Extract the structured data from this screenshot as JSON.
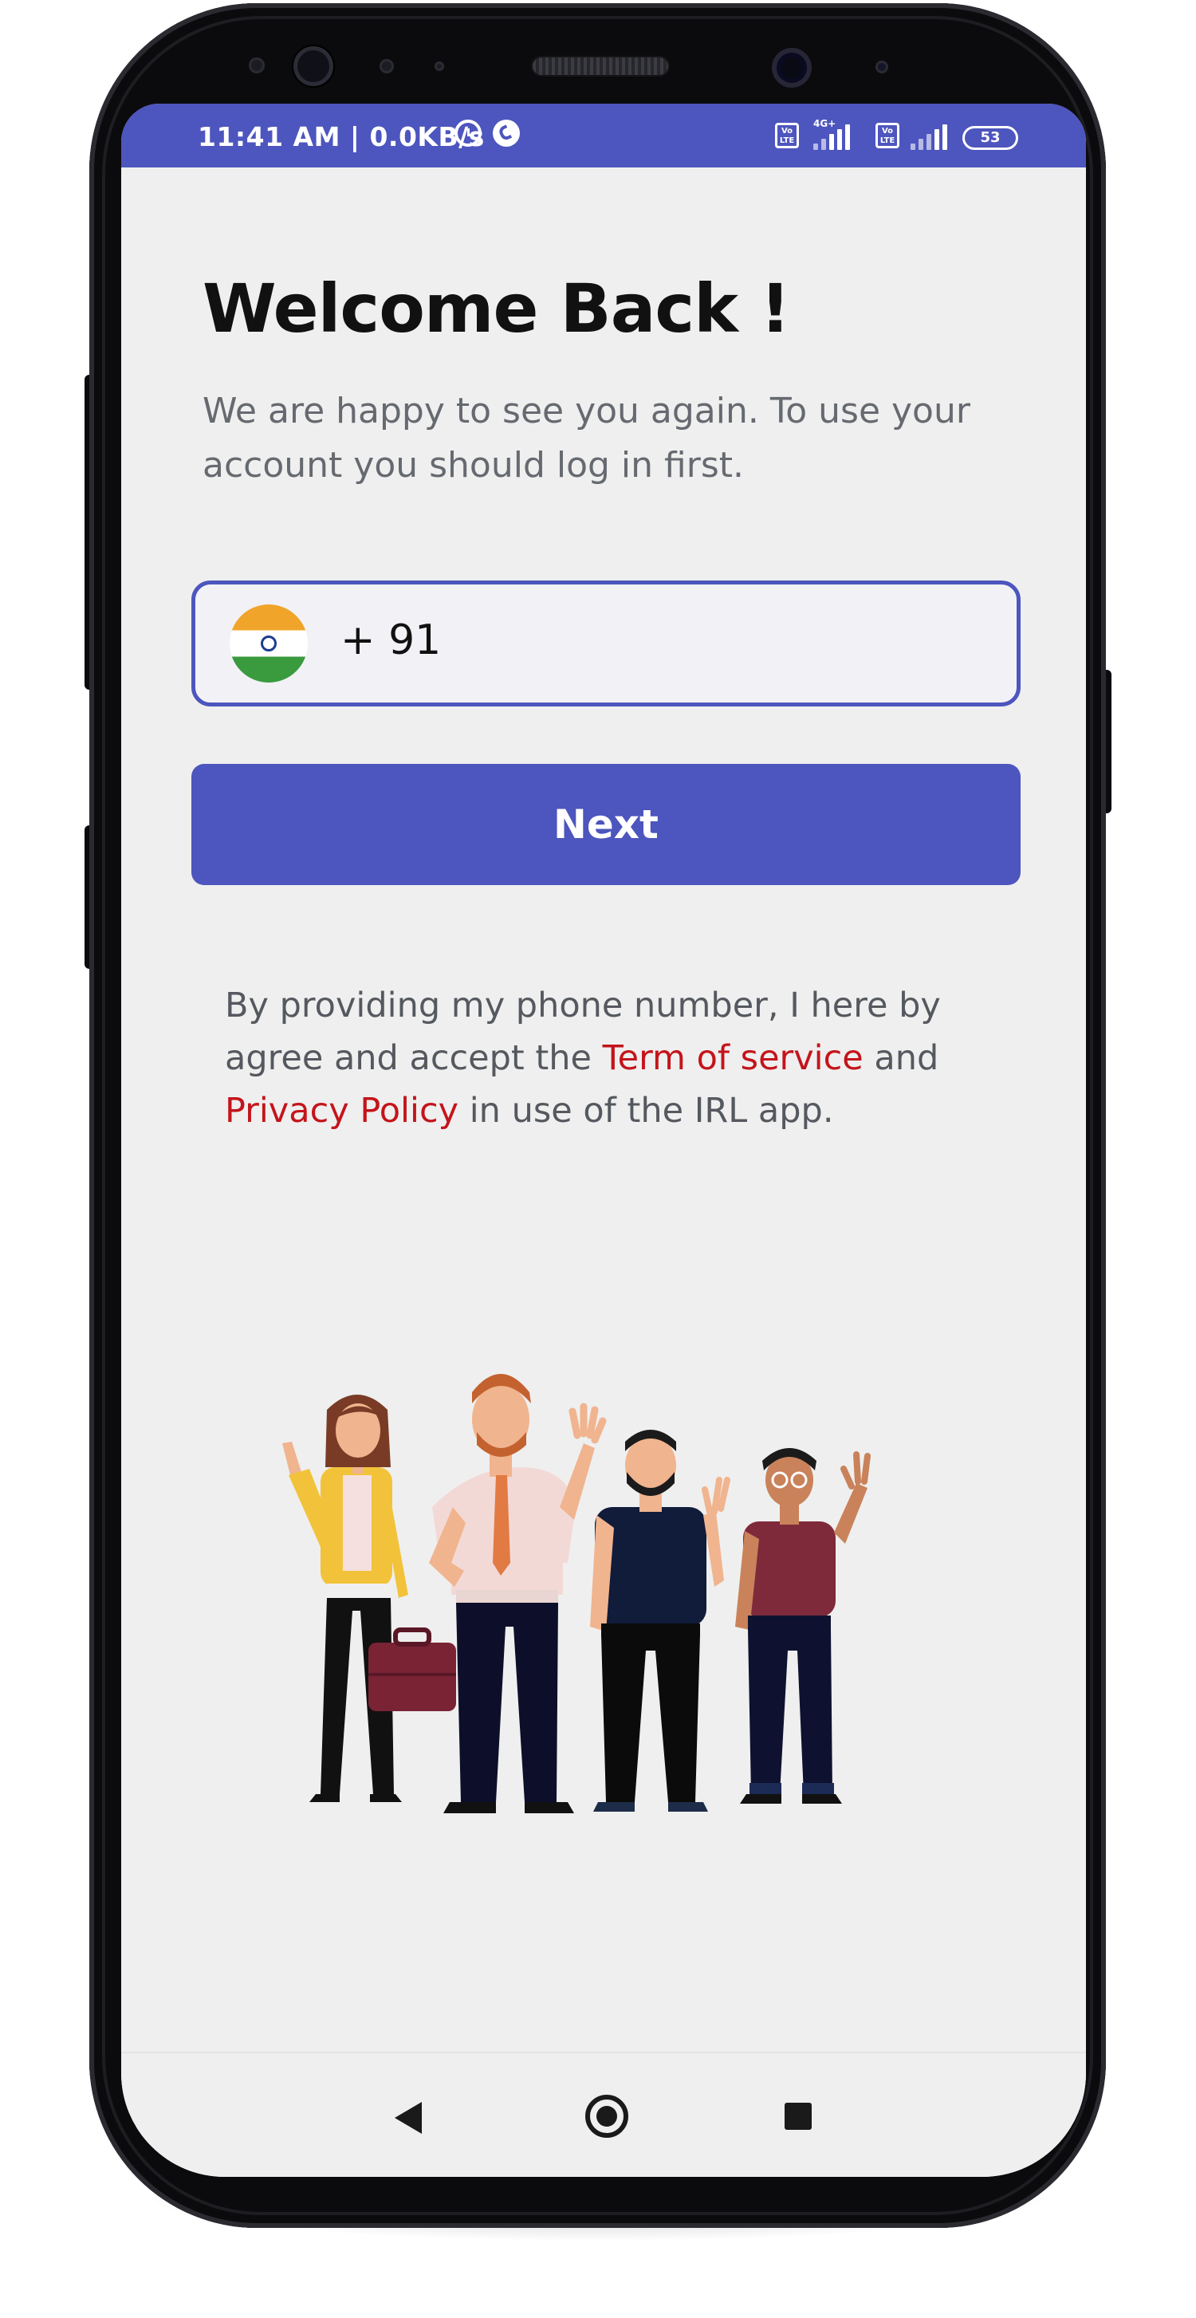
{
  "status_bar": {
    "time_net": "11:41 AM | 0.0KB/s",
    "volte_label": "Vo LTE",
    "network_type": "4G+",
    "battery": "53"
  },
  "login": {
    "title": "Welcome Back !",
    "subtitle": "We are happy to see you again. To use your account you should log in first.",
    "country_code": "+ 91",
    "phone_value": "",
    "next_label": "Next",
    "terms_prefix": "By providing my phone number, I here by agree and accept the ",
    "terms_link": "Term of service",
    "terms_mid": " and ",
    "privacy_link": "Privacy Policy",
    "terms_suffix": " in use of the IRL app."
  },
  "colors": {
    "accent": "#4d55be",
    "link": "#c4141b",
    "background": "#efefef"
  },
  "icons": [
    "alarm-icon",
    "call-icon",
    "signal-icon",
    "battery-icon",
    "india-flag-icon",
    "back-icon",
    "home-icon",
    "recents-icon"
  ]
}
